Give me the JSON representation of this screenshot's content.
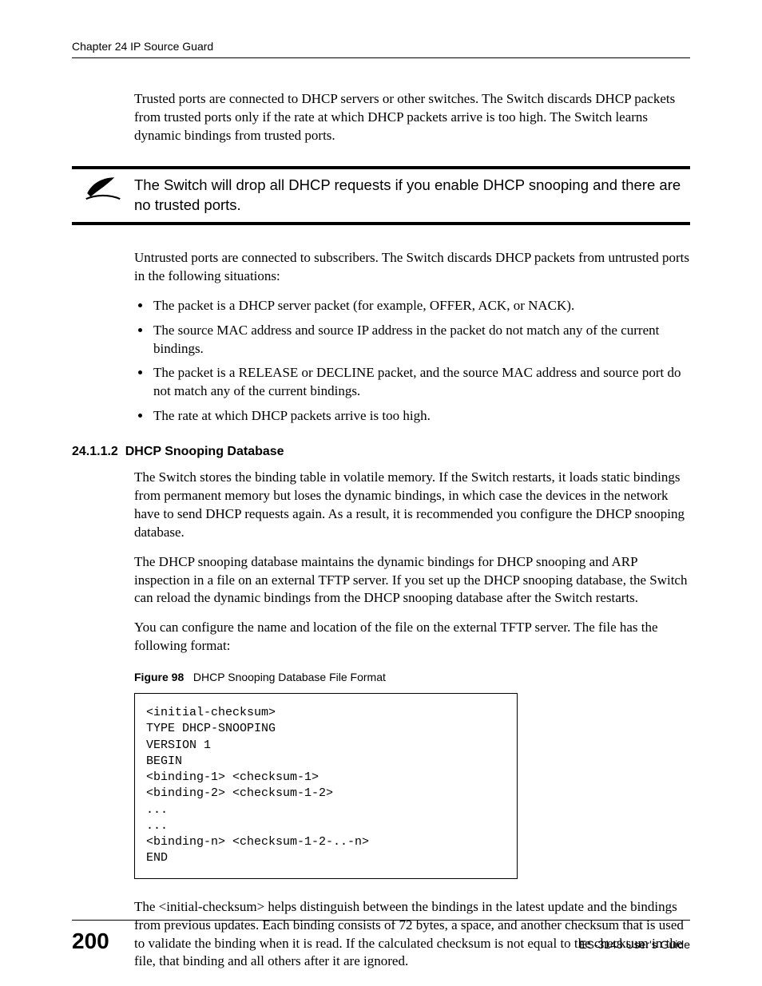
{
  "header": {
    "running": "Chapter 24 IP Source Guard"
  },
  "paragraphs": {
    "intro": "Trusted ports are connected to DHCP servers or other switches. The Switch discards DHCP packets from trusted ports only if the rate at which DHCP packets arrive is too high. The Switch learns dynamic bindings from trusted ports.",
    "note": "The Switch will drop all DHCP requests if you enable DHCP snooping and there are no trusted ports.",
    "untrusted_intro": "Untrusted ports are connected to subscribers. The Switch discards DHCP packets from untrusted ports in the following situations:",
    "db_p1": "The Switch stores the binding table in volatile memory. If the Switch restarts, it loads static bindings from permanent memory but loses the dynamic bindings, in which case the devices in the network have to send DHCP requests again. As a result, it is recommended you configure the DHCP snooping database.",
    "db_p2": "The DHCP snooping database maintains the dynamic bindings for DHCP snooping and ARP inspection in a file on an external TFTP server. If you set up the DHCP snooping database, the Switch can reload the dynamic bindings from the DHCP snooping database after the Switch restarts.",
    "db_p3": "You can configure the name and location of the file on the external TFTP server. The file has the following format:",
    "checksum_p": "The <initial-checksum> helps distinguish between the bindings in the latest update and the bindings from previous updates. Each binding consists of 72 bytes, a space, and another checksum that is used to validate the binding when it is read. If the calculated checksum is not equal to the checksum in the file, that binding and all others after it are ignored."
  },
  "situations": [
    "The packet is a DHCP server packet (for example, OFFER, ACK, or NACK).",
    "The source MAC address and source IP address in the packet do not match any of the current bindings.",
    "The packet is a RELEASE or DECLINE packet, and the source MAC address and source port do not match any of the current bindings.",
    "The rate at which DHCP packets arrive is too high."
  ],
  "section": {
    "number": "24.1.1.2",
    "title": "DHCP Snooping Database"
  },
  "figure": {
    "label": "Figure 98",
    "caption": "DHCP Snooping Database File Format",
    "code": "<initial-checksum>\nTYPE DHCP-SNOOPING\nVERSION 1\nBEGIN\n<binding-1> <checksum-1>\n<binding-2> <checksum-1-2>\n...\n...\n<binding-n> <checksum-1-2-..-n>\nEND"
  },
  "footer": {
    "page_number": "200",
    "guide": "ES-3148 User's Guide"
  }
}
